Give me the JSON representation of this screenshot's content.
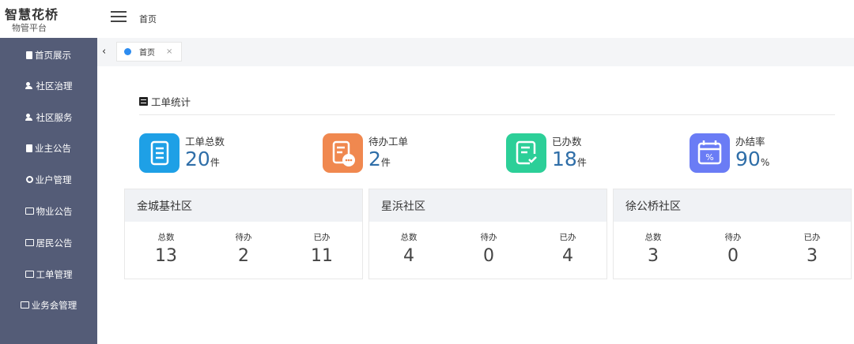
{
  "app": {
    "title": "智慧花桥",
    "subtitle": "物管平台"
  },
  "header": {
    "breadcrumb": "首页"
  },
  "sidebar": {
    "items": [
      {
        "label": "首页展示",
        "icon": "page-icon"
      },
      {
        "label": "社区治理",
        "icon": "group-icon"
      },
      {
        "label": "社区服务",
        "icon": "people-icon"
      },
      {
        "label": "业主公告",
        "icon": "document-icon"
      },
      {
        "label": "业户管理",
        "icon": "gear-icon"
      },
      {
        "label": "物业公告",
        "icon": "folder-icon"
      },
      {
        "label": "居民公告",
        "icon": "folder-icon"
      },
      {
        "label": "工单管理",
        "icon": "folder-icon"
      },
      {
        "label": "业务会管理",
        "icon": "folder-icon"
      }
    ]
  },
  "tabs": {
    "back": "‹",
    "items": [
      {
        "label": "首页",
        "close": "×"
      }
    ]
  },
  "workorder": {
    "title": "工单统计",
    "stats": [
      {
        "label": "工单总数",
        "value": "20",
        "unit": "件",
        "color": "#1ea0e6",
        "icon": "document-list-icon"
      },
      {
        "label": "待办工单",
        "value": "2",
        "unit": "件",
        "color": "#f0884f",
        "icon": "pending-doc-icon"
      },
      {
        "label": "已办数",
        "value": "18",
        "unit": "件",
        "color": "#2ccf98",
        "icon": "done-doc-icon"
      },
      {
        "label": "办结率",
        "value": "90",
        "unit": "%",
        "color": "#6a7cf5",
        "icon": "calendar-percent-icon"
      }
    ]
  },
  "communities": [
    {
      "name": "金城基社区",
      "columns": [
        {
          "label": "总数",
          "value": "13"
        },
        {
          "label": "待办",
          "value": "2"
        },
        {
          "label": "已办",
          "value": "11"
        }
      ]
    },
    {
      "name": "星浜社区",
      "columns": [
        {
          "label": "总数",
          "value": "4"
        },
        {
          "label": "待办",
          "value": "0"
        },
        {
          "label": "已办",
          "value": "4"
        }
      ]
    },
    {
      "name": "徐公桥社区",
      "columns": [
        {
          "label": "总数",
          "value": "3"
        },
        {
          "label": "待办",
          "value": "0"
        },
        {
          "label": "已办",
          "value": "3"
        }
      ]
    }
  ]
}
